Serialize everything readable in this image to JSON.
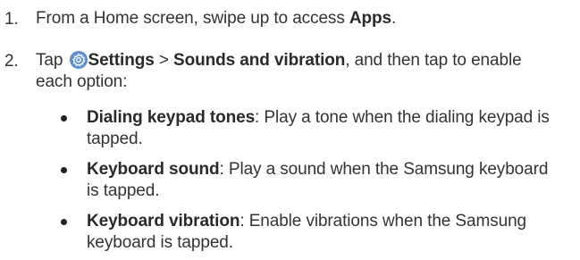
{
  "steps": [
    {
      "number": "1.",
      "pre": "From a Home screen, swipe up to access ",
      "bold1": "Apps",
      "post": "."
    },
    {
      "number": "2.",
      "pre": "Tap ",
      "icon": "settings-gear-icon",
      "bold1": "Settings",
      "separator": " > ",
      "bold2": "Sounds and vibration",
      "post": ", and then tap to enable each option:"
    }
  ],
  "options": [
    {
      "title": "Dialing keypad tones",
      "desc": ": Play a tone when the dialing keypad is tapped."
    },
    {
      "title": "Keyboard sound",
      "desc": ": Play a sound when the Samsung keyboard is tapped."
    },
    {
      "title": "Keyboard vibration",
      "desc": ": Enable vibrations when the Samsung keyboard is tapped."
    }
  ],
  "colors": {
    "icon_bg": "#5a8fd6",
    "text": "#333333"
  }
}
